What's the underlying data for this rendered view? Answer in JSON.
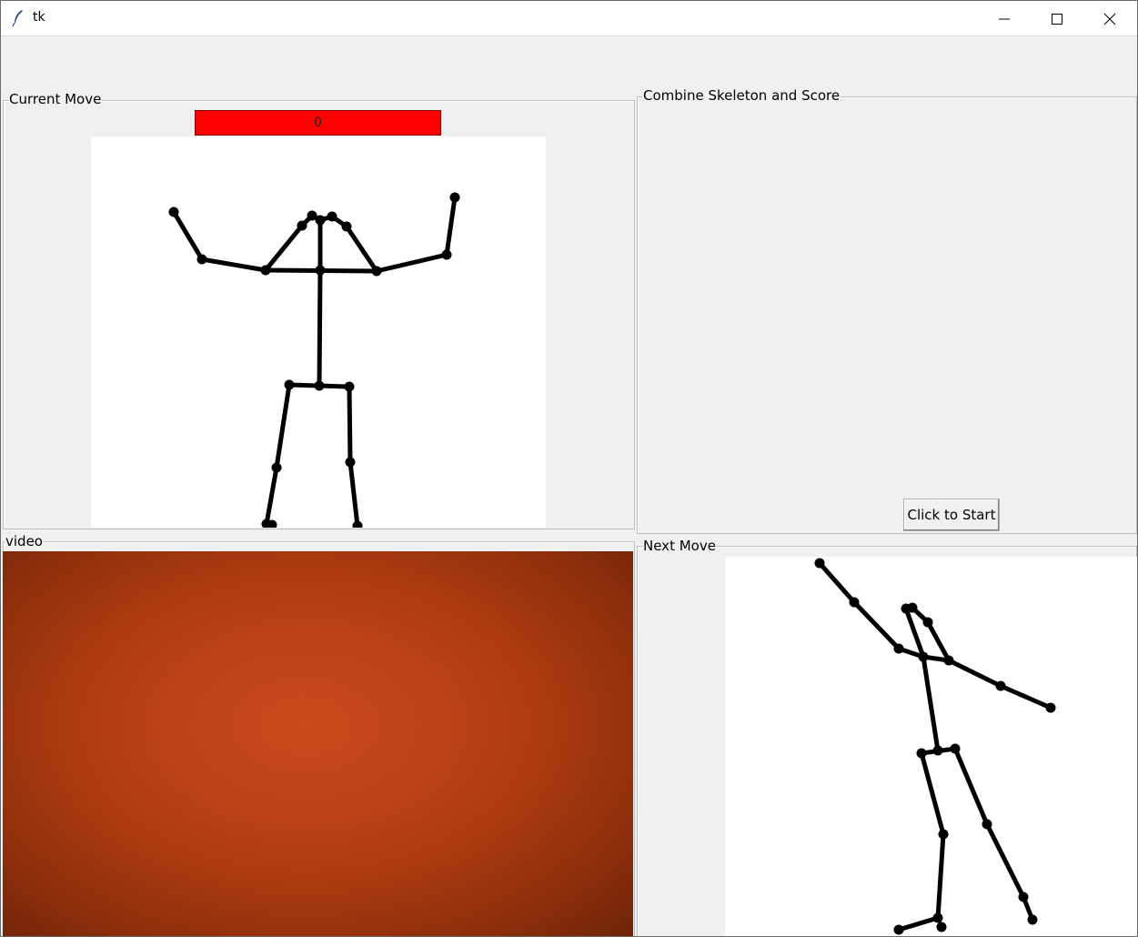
{
  "window": {
    "title": "tk"
  },
  "current_move": {
    "label": "Current Move",
    "score_value": "0",
    "score_color": "#ff0000"
  },
  "combine": {
    "label": "Combine Skeleton and Score",
    "start_button": "Click to Start"
  },
  "video": {
    "label": "video"
  },
  "next_move": {
    "label": "Next Move"
  }
}
